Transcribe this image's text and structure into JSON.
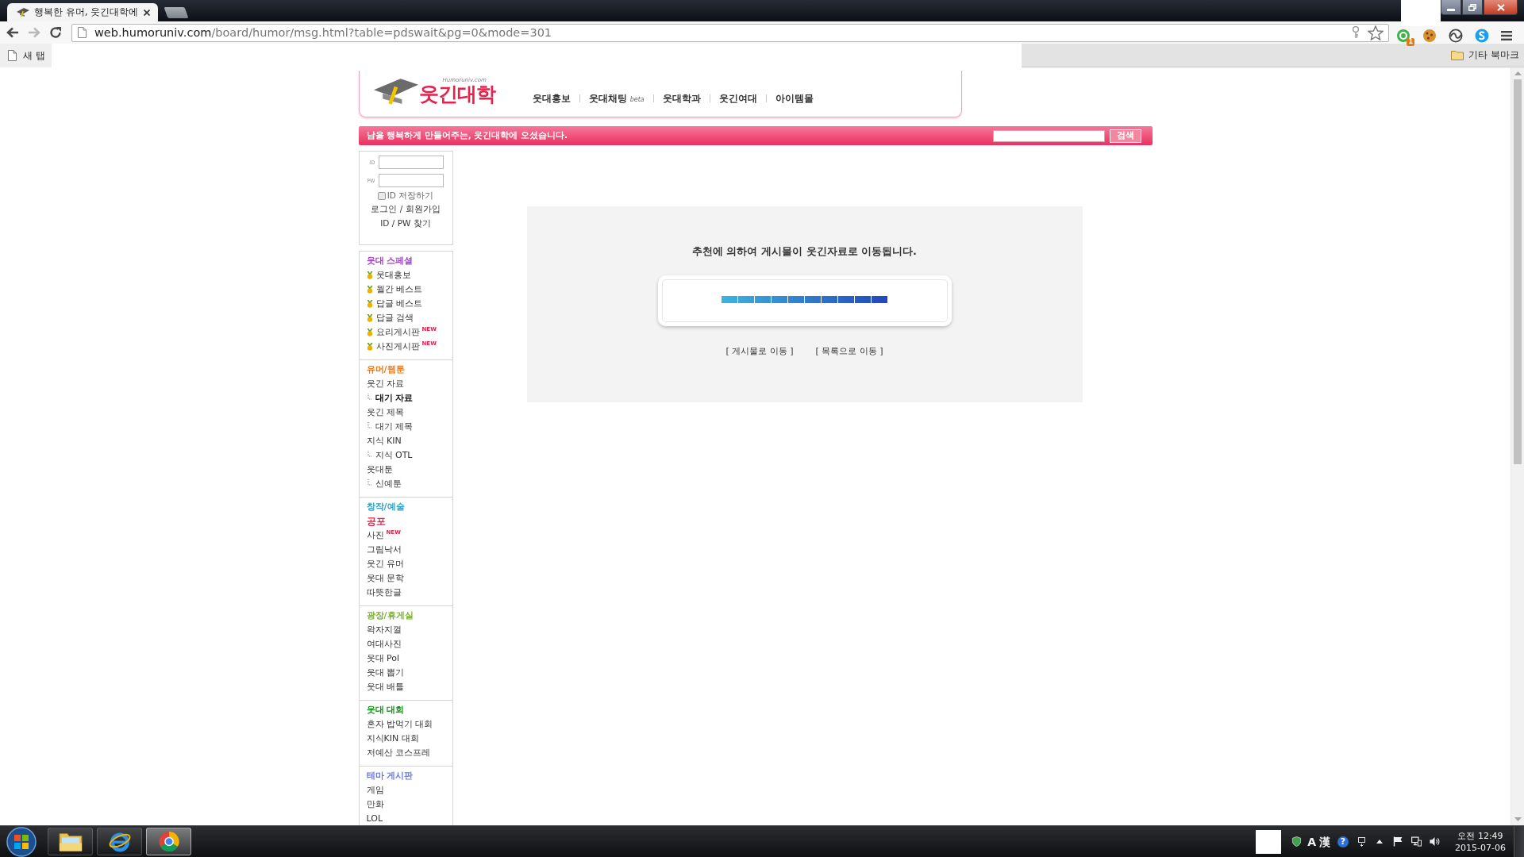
{
  "browser": {
    "tabs": [
      {
        "title": "행복한 유머, 웃긴대학에",
        "selected": true
      }
    ],
    "url": {
      "host": "web.humoruniv.com",
      "path": "/board/humor/msg.html?table=pdswait&pg=0&mode=301"
    },
    "extension_badge": "1",
    "bookmarks": [
      {
        "label": "새 탭"
      }
    ],
    "other_bookmarks": "기타 북마크"
  },
  "header": {
    "logo_domain": "Humoruniv.com",
    "logo_text": "웃긴대학",
    "nav": [
      {
        "label": "웃대홍보"
      },
      {
        "label": "웃대채팅",
        "tag": "beta"
      },
      {
        "label": "웃대학과"
      },
      {
        "label": "웃긴여대"
      },
      {
        "label": "아이템몰"
      }
    ]
  },
  "welcome_bar": {
    "message": "남을 행복하게 만들어주는, 웃긴대학에 오셨습니다.",
    "search_button": "검색"
  },
  "login": {
    "id_label": "ID",
    "pw_label": "PW",
    "remember": {
      "label": "ID 저장하기",
      "checked": false
    },
    "links": [
      "로그인 / 회원가입",
      "ID / PW 찾기"
    ]
  },
  "menu": [
    {
      "title": "웃대 스페셜",
      "color": "#a43ec8",
      "kind": "medal",
      "items": [
        {
          "label": "웃대홍보",
          "selected": false
        },
        {
          "label": "월간 베스트",
          "selected": false
        },
        {
          "label": "답글 베스트",
          "selected": false
        },
        {
          "label": "답글 검색",
          "selected": false
        },
        {
          "label": "요리게시판",
          "badge": "NEW",
          "selected": false
        },
        {
          "label": "사진게시판",
          "badge": "NEW",
          "selected": false
        }
      ]
    },
    {
      "title": "유머/웹툰",
      "color": "#f07818",
      "kind": "plain",
      "items": [
        {
          "label": "웃긴 자료",
          "selected": false,
          "children": [
            {
              "label": "대기 자료",
              "selected": true
            }
          ]
        },
        {
          "label": "웃긴 제목",
          "selected": false,
          "children": [
            {
              "label": "대기 제목",
              "selected": false
            }
          ]
        },
        {
          "label": "지식 KIN",
          "selected": false,
          "children": [
            {
              "label": "지식 OTL",
              "selected": false
            }
          ]
        },
        {
          "label": "웃대툰",
          "selected": false,
          "children": [
            {
              "label": "신예툰",
              "selected": false
            }
          ]
        }
      ]
    },
    {
      "title": "창작/예술",
      "color": "#2aa3c4",
      "kind": "plain",
      "items": [
        {
          "label": "공포",
          "color": "#e8204a",
          "selected": false
        },
        {
          "label": "사진",
          "badge": "NEW",
          "selected": false
        },
        {
          "label": "그림낙서",
          "selected": false
        },
        {
          "label": "웃긴 유머",
          "selected": false
        },
        {
          "label": "웃대 문학",
          "selected": false
        },
        {
          "label": "따뜻한글",
          "selected": false
        }
      ]
    },
    {
      "title": "광장/휴게실",
      "color": "#7ab232",
      "kind": "plain",
      "items": [
        {
          "label": "왁자지껄",
          "selected": false
        },
        {
          "label": "여대사진",
          "selected": false
        },
        {
          "label": "웃대 Pol",
          "selected": false
        },
        {
          "label": "웃대 뽑기",
          "selected": false
        },
        {
          "label": "웃대 배틀",
          "selected": false
        }
      ]
    },
    {
      "title": "웃대 대회",
      "color": "#14911a",
      "kind": "plain",
      "items": [
        {
          "label": "혼자 밥먹기 대회",
          "selected": false
        },
        {
          "label": "지식KIN 대회",
          "selected": false
        },
        {
          "label": "저예산 코스프레",
          "selected": false
        }
      ]
    },
    {
      "title": "테마 게시판",
      "color": "#6878e0",
      "kind": "plain",
      "items": [
        {
          "label": "게임",
          "selected": false
        },
        {
          "label": "만화",
          "selected": false
        },
        {
          "label": "LOL",
          "selected": false
        }
      ]
    }
  ],
  "notice": {
    "message": "추천에 의하여 게시물이 웃긴자료로 이동됩니다.",
    "progress": {
      "level": 1
    },
    "links": [
      "[ 게시물로 이동 ]",
      "[ 목록으로 이동 ]"
    ]
  },
  "taskbar": {
    "apps": [
      {
        "kind": "folder",
        "selected": false
      },
      {
        "kind": "orbit",
        "selected": false
      },
      {
        "kind": "circle",
        "selected": true
      }
    ],
    "ime": [
      "A",
      "漢"
    ],
    "help": "?",
    "time": "오전 12:49",
    "date": "2015-07-06"
  }
}
